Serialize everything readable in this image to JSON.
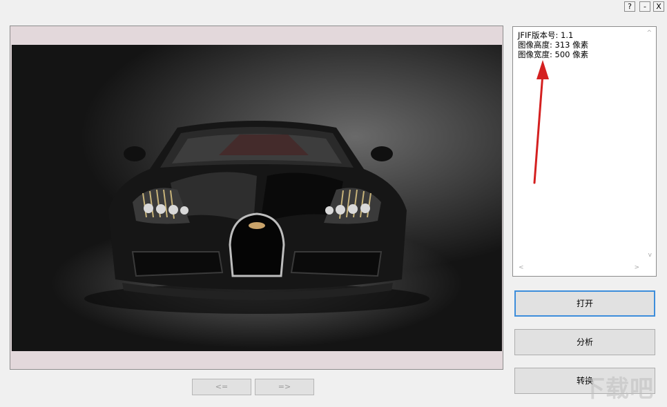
{
  "window": {
    "help_label": "?",
    "minimize_label": "-",
    "close_label": "X"
  },
  "viewer": {
    "image_icon": "car-photo"
  },
  "nav": {
    "prev_label": "<=",
    "next_label": "=>"
  },
  "info": {
    "lines": [
      "JFIF版本号: 1.1",
      "图像高度: 313 像素",
      "图像宽度: 500 像素"
    ],
    "scroll_up_icon": "^",
    "scroll_down_icon": "v",
    "scroll_left_icon": "<",
    "scroll_right_icon": ">"
  },
  "buttons": {
    "open_label": "打开",
    "analyze_label": "分析",
    "convert_label": "转换"
  },
  "watermark": "下载吧",
  "colors": {
    "annotation": "#d42020",
    "focus_border": "#3c8ddb",
    "panel_bg": "#e3d8db"
  }
}
